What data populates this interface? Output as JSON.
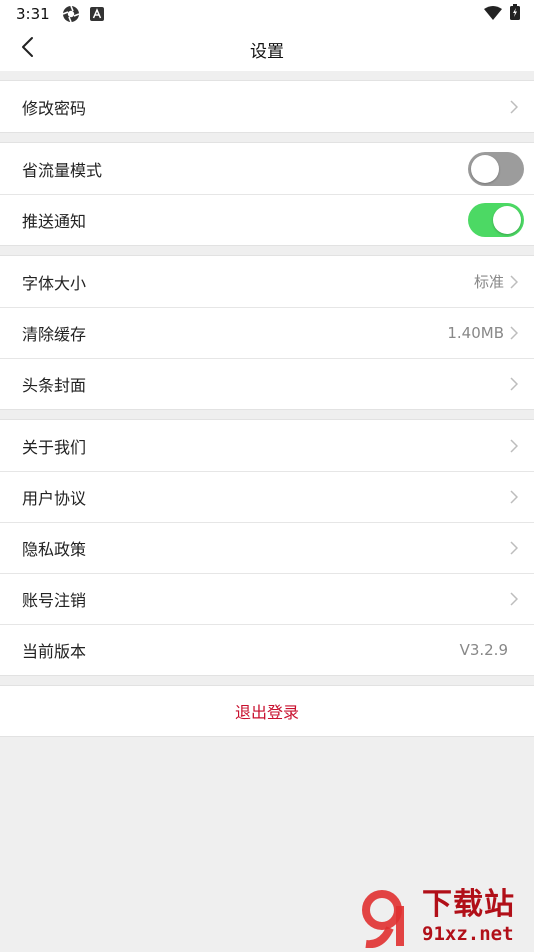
{
  "status_bar": {
    "time": "3:31"
  },
  "header": {
    "title": "设置"
  },
  "groups": [
    {
      "items": [
        {
          "label": "修改密码"
        }
      ]
    },
    {
      "items": [
        {
          "label": "省流量模式",
          "toggle": "off"
        },
        {
          "label": "推送通知",
          "toggle": "on"
        }
      ]
    },
    {
      "items": [
        {
          "label": "字体大小",
          "value": "标准"
        },
        {
          "label": "清除缓存",
          "value": "1.40MB"
        },
        {
          "label": "头条封面"
        }
      ]
    },
    {
      "items": [
        {
          "label": "关于我们"
        },
        {
          "label": "用户协议"
        },
        {
          "label": "隐私政策"
        },
        {
          "label": "账号注销"
        },
        {
          "label": "当前版本",
          "value": "V3.2.9"
        }
      ]
    }
  ],
  "logout": {
    "label": "退出登录"
  },
  "watermark": {
    "title": "下载站",
    "subtitle": "91xz.net"
  },
  "colors": {
    "accent_red": "#c8102e",
    "toggle_on": "#4cd964",
    "toggle_off": "#9c9c9c",
    "background": "#efefef"
  },
  "icons": {
    "back": "chevron-left-icon",
    "row_arrow": "chevron-right-icon",
    "status_app": "aperture-icon",
    "status_font": "font-a-icon",
    "wifi": "wifi-icon",
    "battery": "battery-charging-icon"
  }
}
